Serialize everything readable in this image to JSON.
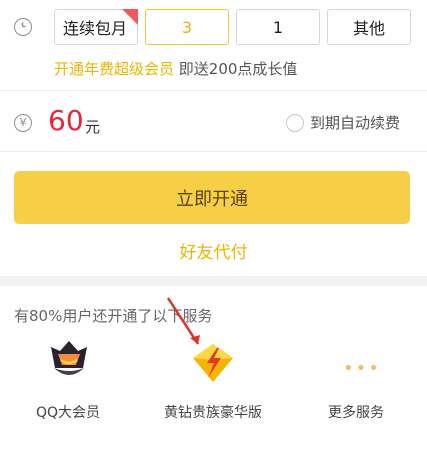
{
  "period": {
    "clock_icon": "clock-icon",
    "options": [
      "连续包月",
      "3",
      "1",
      "其他"
    ],
    "selected_index": 1,
    "corner_badge_color": "#f1595e"
  },
  "promo": {
    "highlight": "开通年费超级会员",
    "rest": " 即送200点成长值"
  },
  "price": {
    "yen_icon": "¥",
    "amount": "60",
    "unit": "元",
    "auto_renew_label": "到期自动续费",
    "auto_renew_checked": false
  },
  "actions": {
    "primary": "立即开通",
    "secondary": "好友代付"
  },
  "suggest": {
    "title": "有80%用户还开通了以下服务",
    "services": [
      {
        "label": "QQ大会员",
        "icon": "qq-big-member-icon"
      },
      {
        "label": "黄钻贵族豪华版",
        "icon": "yellow-diamond-icon"
      },
      {
        "label": "更多服务",
        "icon": "more-dots-icon"
      }
    ]
  },
  "colors": {
    "accent": "#f7cf47",
    "price_red": "#e6283c",
    "highlight": "#f0b400",
    "arrow_red": "#e0302a"
  }
}
